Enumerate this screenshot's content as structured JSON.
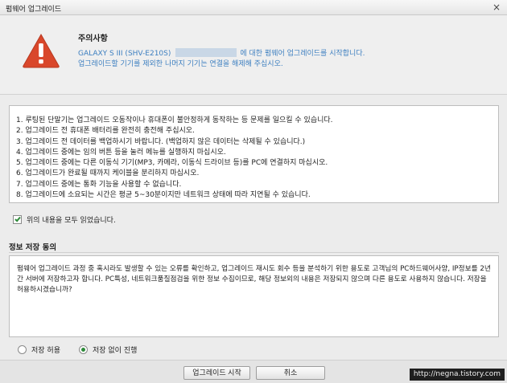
{
  "window": {
    "title": "펌웨어 업그레이드",
    "close_glyph": "×"
  },
  "notice": {
    "icon": "warning-triangle-icon",
    "icon_color": "#d9472b",
    "title": "주의사항",
    "line1_start": "GALAXY S III (SHV-E210S)",
    "line1_end": "에 대한 펌웨어 업그레이드를 시작합니다.",
    "line2": "업그레이드할 기기를 제외한 나머지 기기는 연결을 해제해 주십시오."
  },
  "instructions": [
    "1. 루팅된 단말기는 업그레이드 오동작이나 휴대폰이 불안정하게 동작하는 등 문제를 일으킬 수 있습니다.",
    "2. 업그레이드 전 휴대폰 배터리를 완전히 충전해 주십시오.",
    "3. 업그레이드 전 데이터를 백업하시기 바랍니다. (백업하지 않은 데이터는 삭제될 수 있습니다.)",
    "4. 업그레이드 중에는 임의 버튼 등을 눌러 메뉴를 실행하지 마십시오.",
    "5. 업그레이드 중에는 다른 이동식 기기(MP3, 카메라, 이동식 드라이브 등)를 PC에 연결하지 마십시오.",
    "6. 업그레이드가 완료될 때까지 케이블을 분리하지 마십시오.",
    "7. 업그레이드 중에는 통화 기능을 사용할 수 없습니다.",
    "8. 업그레이드에 소요되는 시간은 평균 5~30분이지만 네트워크 상태에 따라 지연될 수 있습니다."
  ],
  "agree": {
    "label": "위의 내용을 모두 읽었습니다.",
    "checked": true
  },
  "consent": {
    "title": "정보 저장 동의",
    "text": "펌웨어 업그레이드 과정 중 혹시라도 발생할 수 있는 오류를 확인하고, 업그레이드 재시도 회수 등을 분석하기 위한 용도로 고객님의 PC하드웨어사양, IP정보를 2년간 서버에 저장하고자 합니다. PC특성, 네트워크품질점검을 위한 정보 수집이므로, 해당 정보외의 내용은 저장되지 않으며 다른 용도로 사용하지 않습니다. 저장을 허용하시겠습니까?",
    "options": [
      {
        "label": "저장 허용",
        "selected": false
      },
      {
        "label": "저장 없이 진행",
        "selected": true
      }
    ]
  },
  "buttons": {
    "start": "업그레이드 시작",
    "cancel": "취소"
  },
  "watermark": "http://negna.tistory.com",
  "colors": {
    "accent_text": "#3d7fc0",
    "check": "#2e8b3a"
  }
}
